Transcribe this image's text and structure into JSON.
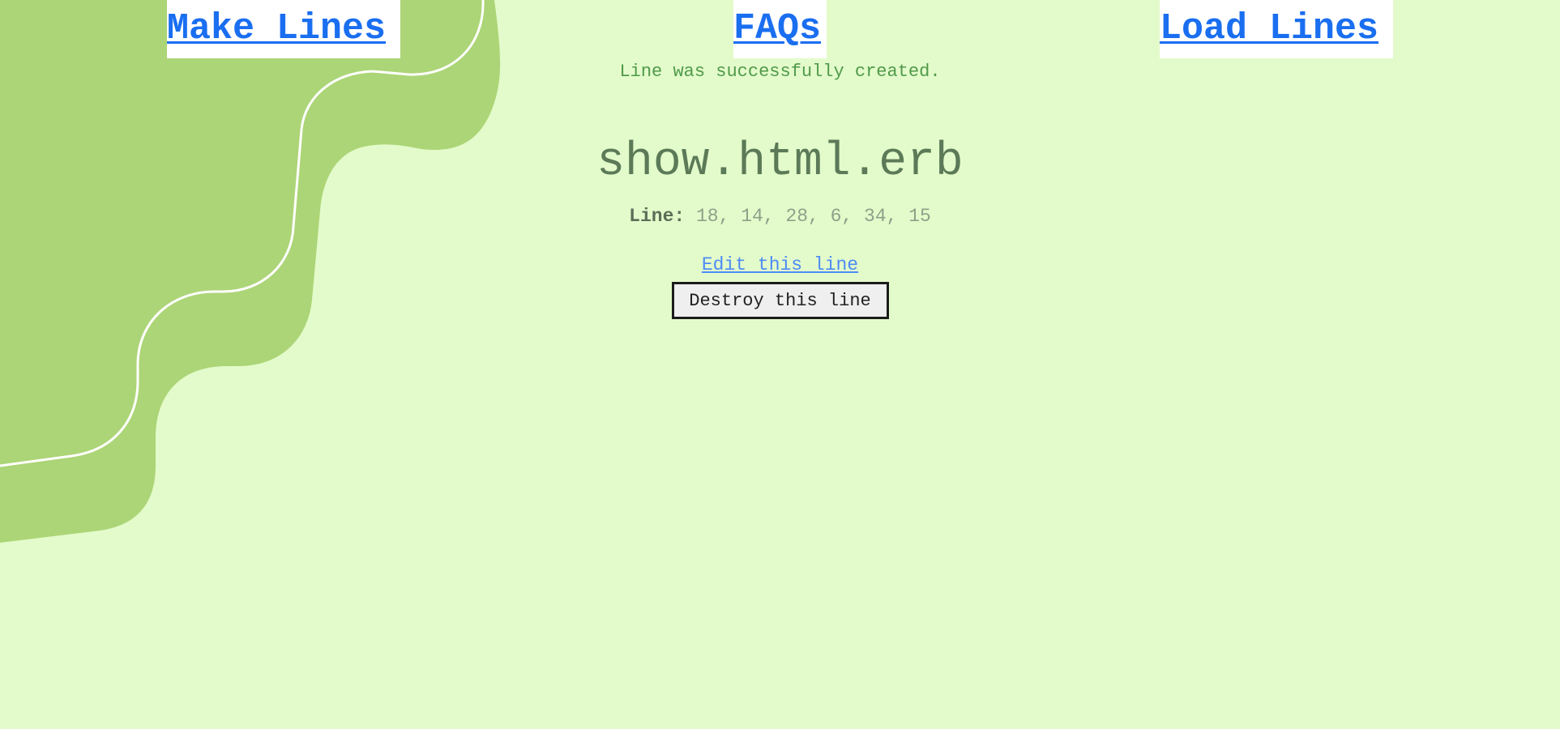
{
  "nav": {
    "make_lines": "Make Lines",
    "faqs": "FAQs",
    "load_lines": "Load Lines"
  },
  "notice": "Line was successfully created.",
  "page_title": "show.html.erb",
  "line": {
    "label": "Line:",
    "values": "18, 14, 28, 6, 34, 15"
  },
  "actions": {
    "edit": "Edit this line",
    "destroy": "Destroy this line"
  },
  "colors": {
    "background": "#e3fbca",
    "wave": "#acd577",
    "link": "#1a6ef0",
    "notice": "#4f9a4b"
  }
}
